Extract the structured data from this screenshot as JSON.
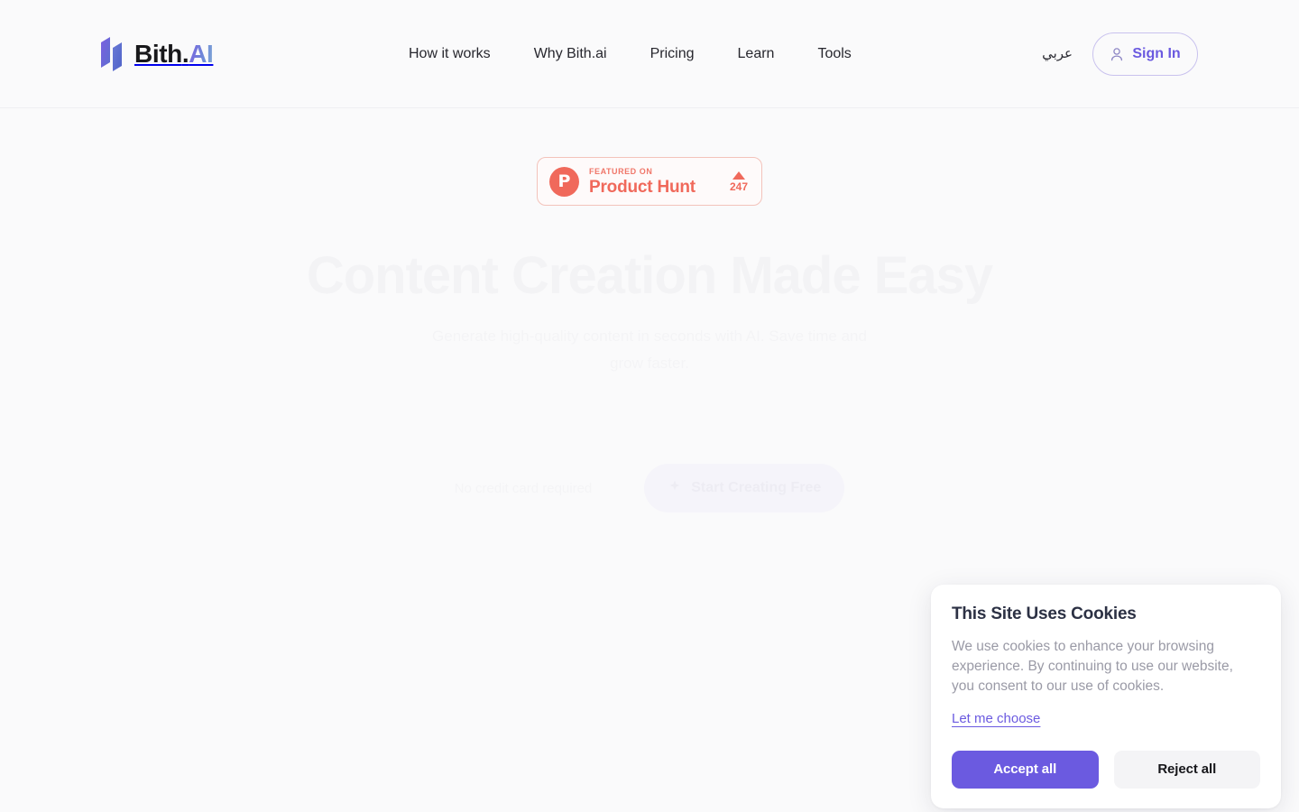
{
  "header": {
    "logo": {
      "name": "Bith",
      "dot": ".",
      "suffix": "AI",
      "icon": "bith-bars-logo-icon"
    },
    "nav": [
      {
        "label": "How it works"
      },
      {
        "label": "Why Bith.ai"
      },
      {
        "label": "Pricing"
      },
      {
        "label": "Learn"
      },
      {
        "label": "Tools"
      }
    ],
    "language_toggle": "عربي",
    "signin": {
      "label": "Sign In",
      "icon": "user-icon"
    }
  },
  "hero": {
    "product_hunt": {
      "badge_letter": "P",
      "kicker": "FEATURED ON",
      "name": "Product Hunt",
      "upvote_icon": "caret-up-icon",
      "votes": "247",
      "accent_color": "#f0695b"
    },
    "title": "Content Creation Made Easy",
    "subtitle": "Generate high-quality content in seconds with AI. Save time and grow faster.",
    "cta_note": "No credit card required",
    "cta_label": "Start Creating Free"
  },
  "cookie_dialog": {
    "title": "This Site Uses Cookies",
    "body": "We use cookies to enhance your browsing experience. By continuing to use our website, you consent to our use of cookies.",
    "choose_link": "Let me choose",
    "accept_label": "Accept all",
    "reject_label": "Reject all",
    "accent_color": "#6b5ae0"
  }
}
